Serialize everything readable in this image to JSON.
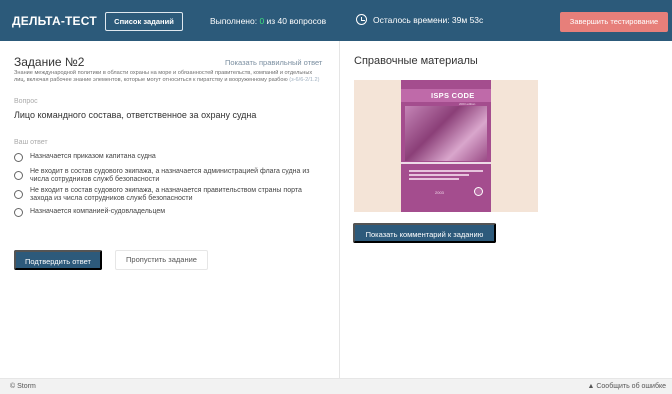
{
  "header": {
    "brand": "ДЕЛЬТА-ТЕСТ",
    "tasks_button": "Список заданий",
    "progress_prefix": "Выполнено: ",
    "progress_done": "0",
    "progress_suffix": " из 40 вопросов",
    "timer": "Осталось времени: 39м 53с",
    "finish_button": "Завершить тестирование"
  },
  "task": {
    "title": "Задание №2",
    "show_answer": "Показать правильный ответ",
    "description": "Знание международной политики в области охраны на море и обязанностей правительств, компаний и отдельных лиц, включая рабочее знание элементов, которые могут относиться к пиратству и вооруженному разбою",
    "code": "(з-6/6-2/1.2)",
    "question_label": "Вопрос",
    "question": "Лицо командного состава, ответственное за охрану судна",
    "answer_label": "Ваш ответ",
    "options": [
      "Назначается приказом капитана судна",
      "Не входит в состав судового экипажа, а назначается администрацией флага судна из числа сотрудников служб безопасности",
      "Не входит в состав судового экипажа, а назначается правительством страны порта захода из числа сотрудников служб безопасности",
      "Назначается компанией-судовладельцем"
    ],
    "confirm_button": "Подтвердить ответ",
    "skip_button": "Пропустить задание"
  },
  "reference": {
    "title": "Справочные материалы",
    "book_logo": "ISPS CODE",
    "book_subtitle": "2003 edition",
    "book_edition": "2003",
    "comment_button": "Показать комментарий к заданию"
  },
  "footer": {
    "copyright": "© Storm",
    "report": "Сообщить об ошибке",
    "report_icon": "▲"
  },
  "colors": {
    "header_bg": "#2c5a7a",
    "accent_green": "#3fe07d",
    "finish_red": "#e77f7a",
    "book_purple": "#a44d8e"
  }
}
